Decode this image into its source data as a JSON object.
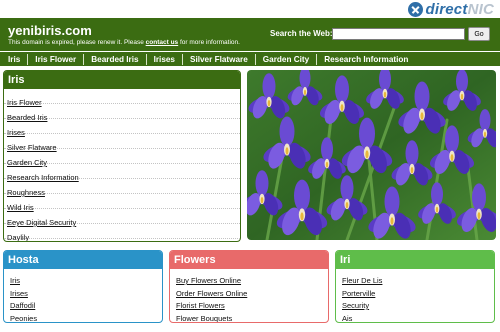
{
  "brand": {
    "direct": "direct",
    "nic": "NIC"
  },
  "header": {
    "site_name": "yenibiris.com",
    "expired_before": "This domain is expired, please renew it. Please ",
    "contact_link": "contact us",
    "expired_after": " for more information.",
    "search_label": "Search the Web:",
    "search_value": "",
    "go_label": "Go"
  },
  "nav": [
    "Iris",
    "Iris Flower",
    "Bearded Iris",
    "Irises",
    "Silver Flatware",
    "Garden City",
    "Research Information"
  ],
  "iris_panel": {
    "title": "Iris",
    "links": [
      "Iris Flower",
      "Bearded Iris",
      "Irises",
      "Silver Flatware",
      "Garden City",
      "Research Information",
      "Roughness",
      "Wild Iris",
      "Eeye Digital Security",
      "Daylily"
    ]
  },
  "boxes": {
    "hosta": {
      "title": "Hosta",
      "links": [
        "Iris",
        "Irises",
        "Daffodil",
        "Peonies"
      ]
    },
    "flowers": {
      "title": "Flowers",
      "links": [
        "Buy Flowers Online",
        "Order Flowers Online",
        "Florist Flowers",
        "Flower Bouquets"
      ]
    },
    "iri": {
      "title": "Iri",
      "links": [
        "Fleur De Lis",
        "Porterville",
        "Security",
        "Ais"
      ]
    }
  },
  "colors": {
    "header_green": "#3b6c12",
    "hosta_blue": "#2a93c8",
    "flowers_red": "#e86a6a",
    "iri_green": "#5fbd4a",
    "brand_blue": "#2f6fa8"
  }
}
